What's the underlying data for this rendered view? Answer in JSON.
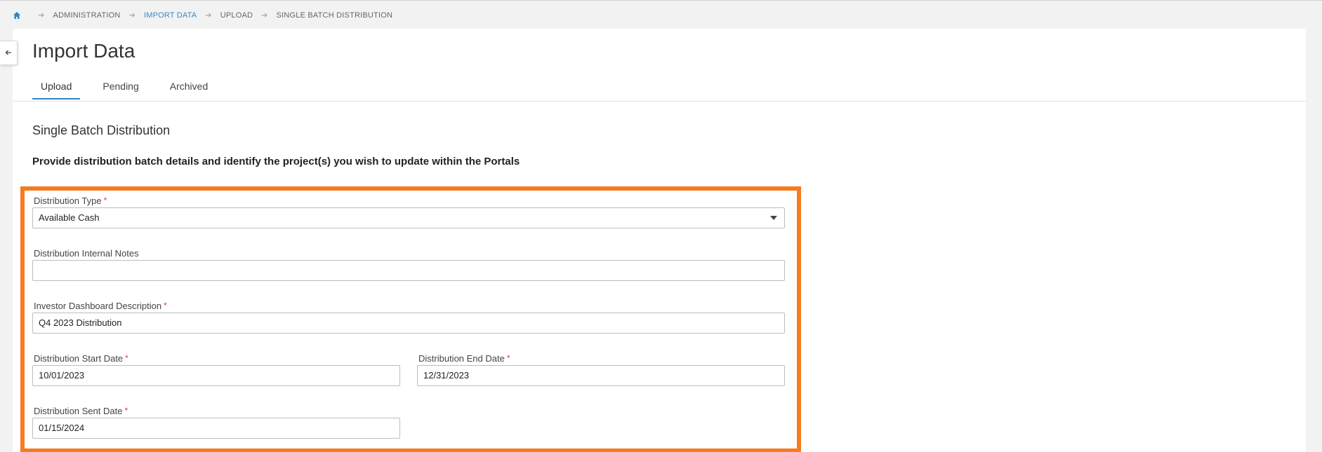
{
  "breadcrumb": {
    "items": [
      "ADMINISTRATION",
      "IMPORT DATA",
      "UPLOAD",
      "SINGLE BATCH DISTRIBUTION"
    ]
  },
  "page": {
    "title": "Import Data",
    "tabs": [
      {
        "label": "Upload"
      },
      {
        "label": "Pending"
      },
      {
        "label": "Archived"
      }
    ],
    "section_title": "Single Batch Distribution",
    "instruction": "Provide distribution batch details and identify the project(s) you wish to update within the Portals"
  },
  "form": {
    "distribution_type": {
      "label": "Distribution Type",
      "value": "Available Cash"
    },
    "internal_notes": {
      "label": "Distribution Internal Notes",
      "value": ""
    },
    "dashboard_description": {
      "label": "Investor Dashboard Description",
      "value": "Q4 2023 Distribution"
    },
    "start_date": {
      "label": "Distribution Start Date",
      "value": "10/01/2023"
    },
    "end_date": {
      "label": "Distribution End Date",
      "value": "12/31/2023"
    },
    "sent_date": {
      "label": "Distribution Sent Date",
      "value": "01/15/2024"
    },
    "required_marker": "*"
  },
  "colors": {
    "accent": "#2f86c2",
    "highlight_frame": "#f57c20",
    "required": "#e53935"
  },
  "icons": {
    "home": "home-icon",
    "breadcrumb_separator": "arrow-right-icon",
    "collapse": "arrow-left-icon",
    "dropdown": "caret-down-icon"
  }
}
